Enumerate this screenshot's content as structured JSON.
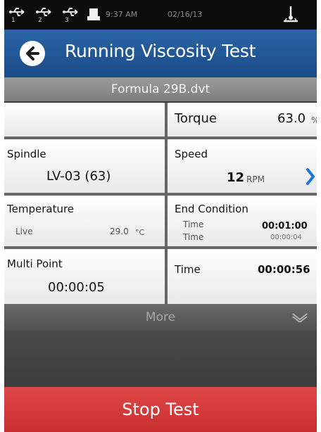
{
  "status_bar": {
    "usb_ports": [
      "1",
      "2",
      "3"
    ],
    "time": "9:37 AM",
    "date": "02/16/13"
  },
  "header": {
    "title": "Running Viscosity Test"
  },
  "file": {
    "name": "Formula 29B.dvt"
  },
  "readings": {
    "torque": {
      "label": "Torque",
      "value": "63.0",
      "unit": "%"
    },
    "spindle": {
      "label": "Spindle",
      "value": "LV-03 (63)"
    },
    "speed": {
      "label": "Speed",
      "value": "12",
      "unit": "RPM"
    },
    "temperature": {
      "label": "Temperature",
      "mode": "Live",
      "value": "29.0",
      "unit": "°C"
    },
    "end_condition": {
      "label": "End Condition",
      "row1_label": "Time",
      "row1_value": "00:01:00",
      "row2_label": "Time",
      "row2_value": "00:00:04"
    },
    "multi_point": {
      "label": "Multi Point",
      "value": "00:00:05"
    },
    "time": {
      "label": "Time",
      "value": "00:00:56"
    }
  },
  "more": {
    "label": "More"
  },
  "actions": {
    "stop_label": "Stop Test"
  },
  "colors": {
    "title_bar": "#1f5799",
    "stop_button": "#d63b3b",
    "accent_blue": "#1a78d6"
  }
}
